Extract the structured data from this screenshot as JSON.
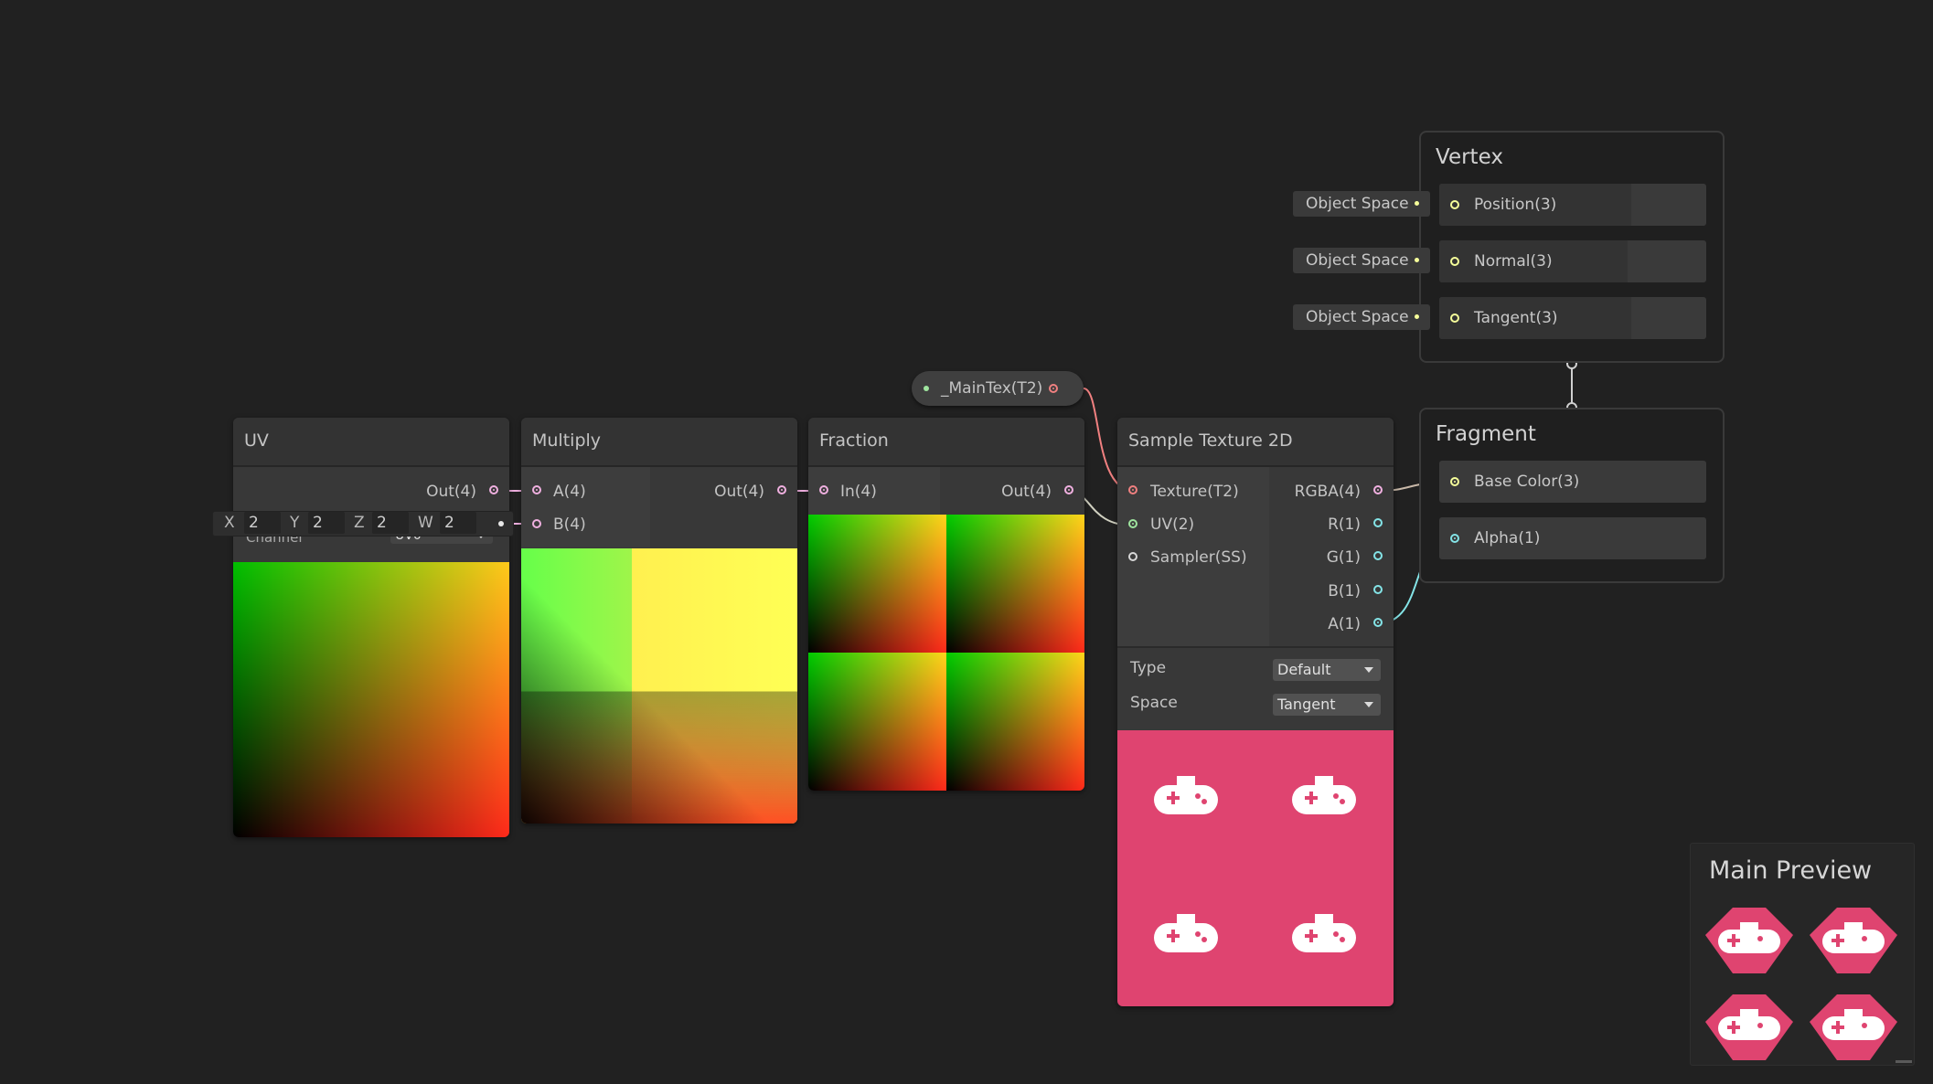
{
  "colors": {
    "background": "#212121",
    "node_body": "#383838",
    "texture_port": "#f08080",
    "vector4_port": "#f0b0e0",
    "vector2_port": "#9fe59f",
    "vector1_port": "#84e4e7",
    "vector3_port": "#f6ff9a",
    "sample_preview": "#e04470"
  },
  "nodes": {
    "uv": {
      "title": "UV",
      "out": "Out(4)",
      "channel_label": "Channel",
      "channel_value": "UV0"
    },
    "vector_input": {
      "x_label": "X",
      "x_value": "2",
      "y_label": "Y",
      "y_value": "2",
      "z_label": "Z",
      "z_value": "2",
      "w_label": "W",
      "w_value": "2"
    },
    "multiply": {
      "title": "Multiply",
      "in_a": "A(4)",
      "in_b": "B(4)",
      "out": "Out(4)"
    },
    "fraction": {
      "title": "Fraction",
      "in": "In(4)",
      "out": "Out(4)"
    },
    "property": {
      "label": "_MainTex(T2)"
    },
    "sample_texture": {
      "title": "Sample Texture 2D",
      "in_texture": "Texture(T2)",
      "in_uv": "UV(2)",
      "in_sampler": "Sampler(SS)",
      "out_rgba": "RGBA(4)",
      "out_r": "R(1)",
      "out_g": "G(1)",
      "out_b": "B(1)",
      "out_a": "A(1)",
      "type_label": "Type",
      "type_value": "Default",
      "space_label": "Space",
      "space_value": "Tangent"
    }
  },
  "vertex": {
    "title": "Vertex",
    "blocks": [
      {
        "label": "Position(3)",
        "space": "Object Space"
      },
      {
        "label": "Normal(3)",
        "space": "Object Space"
      },
      {
        "label": "Tangent(3)",
        "space": "Object Space"
      }
    ]
  },
  "fragment": {
    "title": "Fragment",
    "blocks": [
      {
        "label": "Base Color(3)"
      },
      {
        "label": "Alpha(1)"
      }
    ]
  },
  "main_preview": {
    "title": "Main Preview"
  },
  "icons": [
    "gamepad-icon"
  ]
}
